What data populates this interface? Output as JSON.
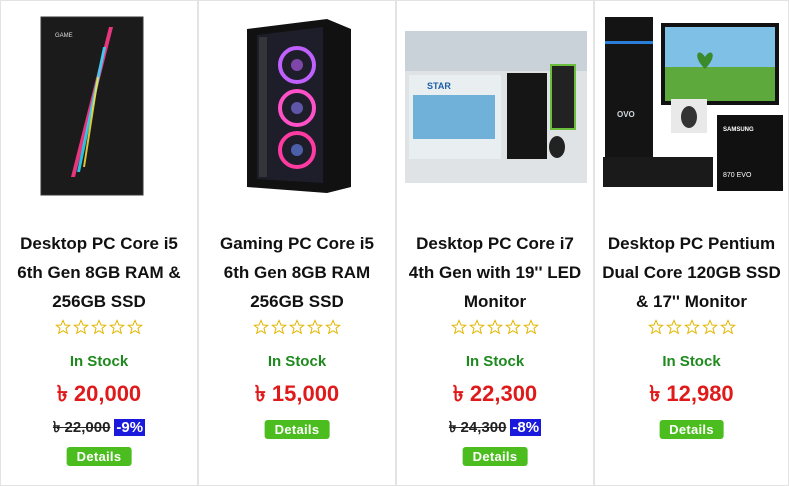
{
  "products": [
    {
      "title_lines": [
        "Desktop PC Core i5",
        "6th Gen 8GB RAM &",
        "256GB SSD"
      ],
      "stock": "In Stock",
      "price": "৳ 20,000",
      "old_price": "৳ 22,000",
      "discount": "-9%",
      "rating": 0,
      "button": "Details"
    },
    {
      "title_lines": [
        "Gaming PC Core i5",
        "6th Gen 8GB RAM",
        "256GB SSD"
      ],
      "stock": "In Stock",
      "price": "৳ 15,000",
      "rating": 0,
      "button": "Details"
    },
    {
      "title_lines": [
        "Desktop PC Core i7",
        "4th Gen with 19'' LED",
        "Monitor"
      ],
      "stock": "In Stock",
      "price": "৳ 22,300",
      "old_price": "৳ 24,300",
      "discount": "-8%",
      "rating": 0,
      "button": "Details"
    },
    {
      "title_lines": [
        "Desktop PC Pentium",
        "Dual Core 120GB SSD",
        "& 17'' Monitor"
      ],
      "stock": "In Stock",
      "price": "৳ 12,980",
      "rating": 0,
      "button": "Details"
    }
  ],
  "image_text": {
    "p1_label": "GAME",
    "p3_brand": "STAR",
    "p4_brand": "OVO",
    "p4_ssd_brand": "SAMSUNG",
    "p4_ssd_model": "870 EVO"
  },
  "colors": {
    "price": "#e01a1a",
    "stock": "#1e8a1e",
    "button": "#4bbd1e",
    "discount": "#1a1adc"
  }
}
